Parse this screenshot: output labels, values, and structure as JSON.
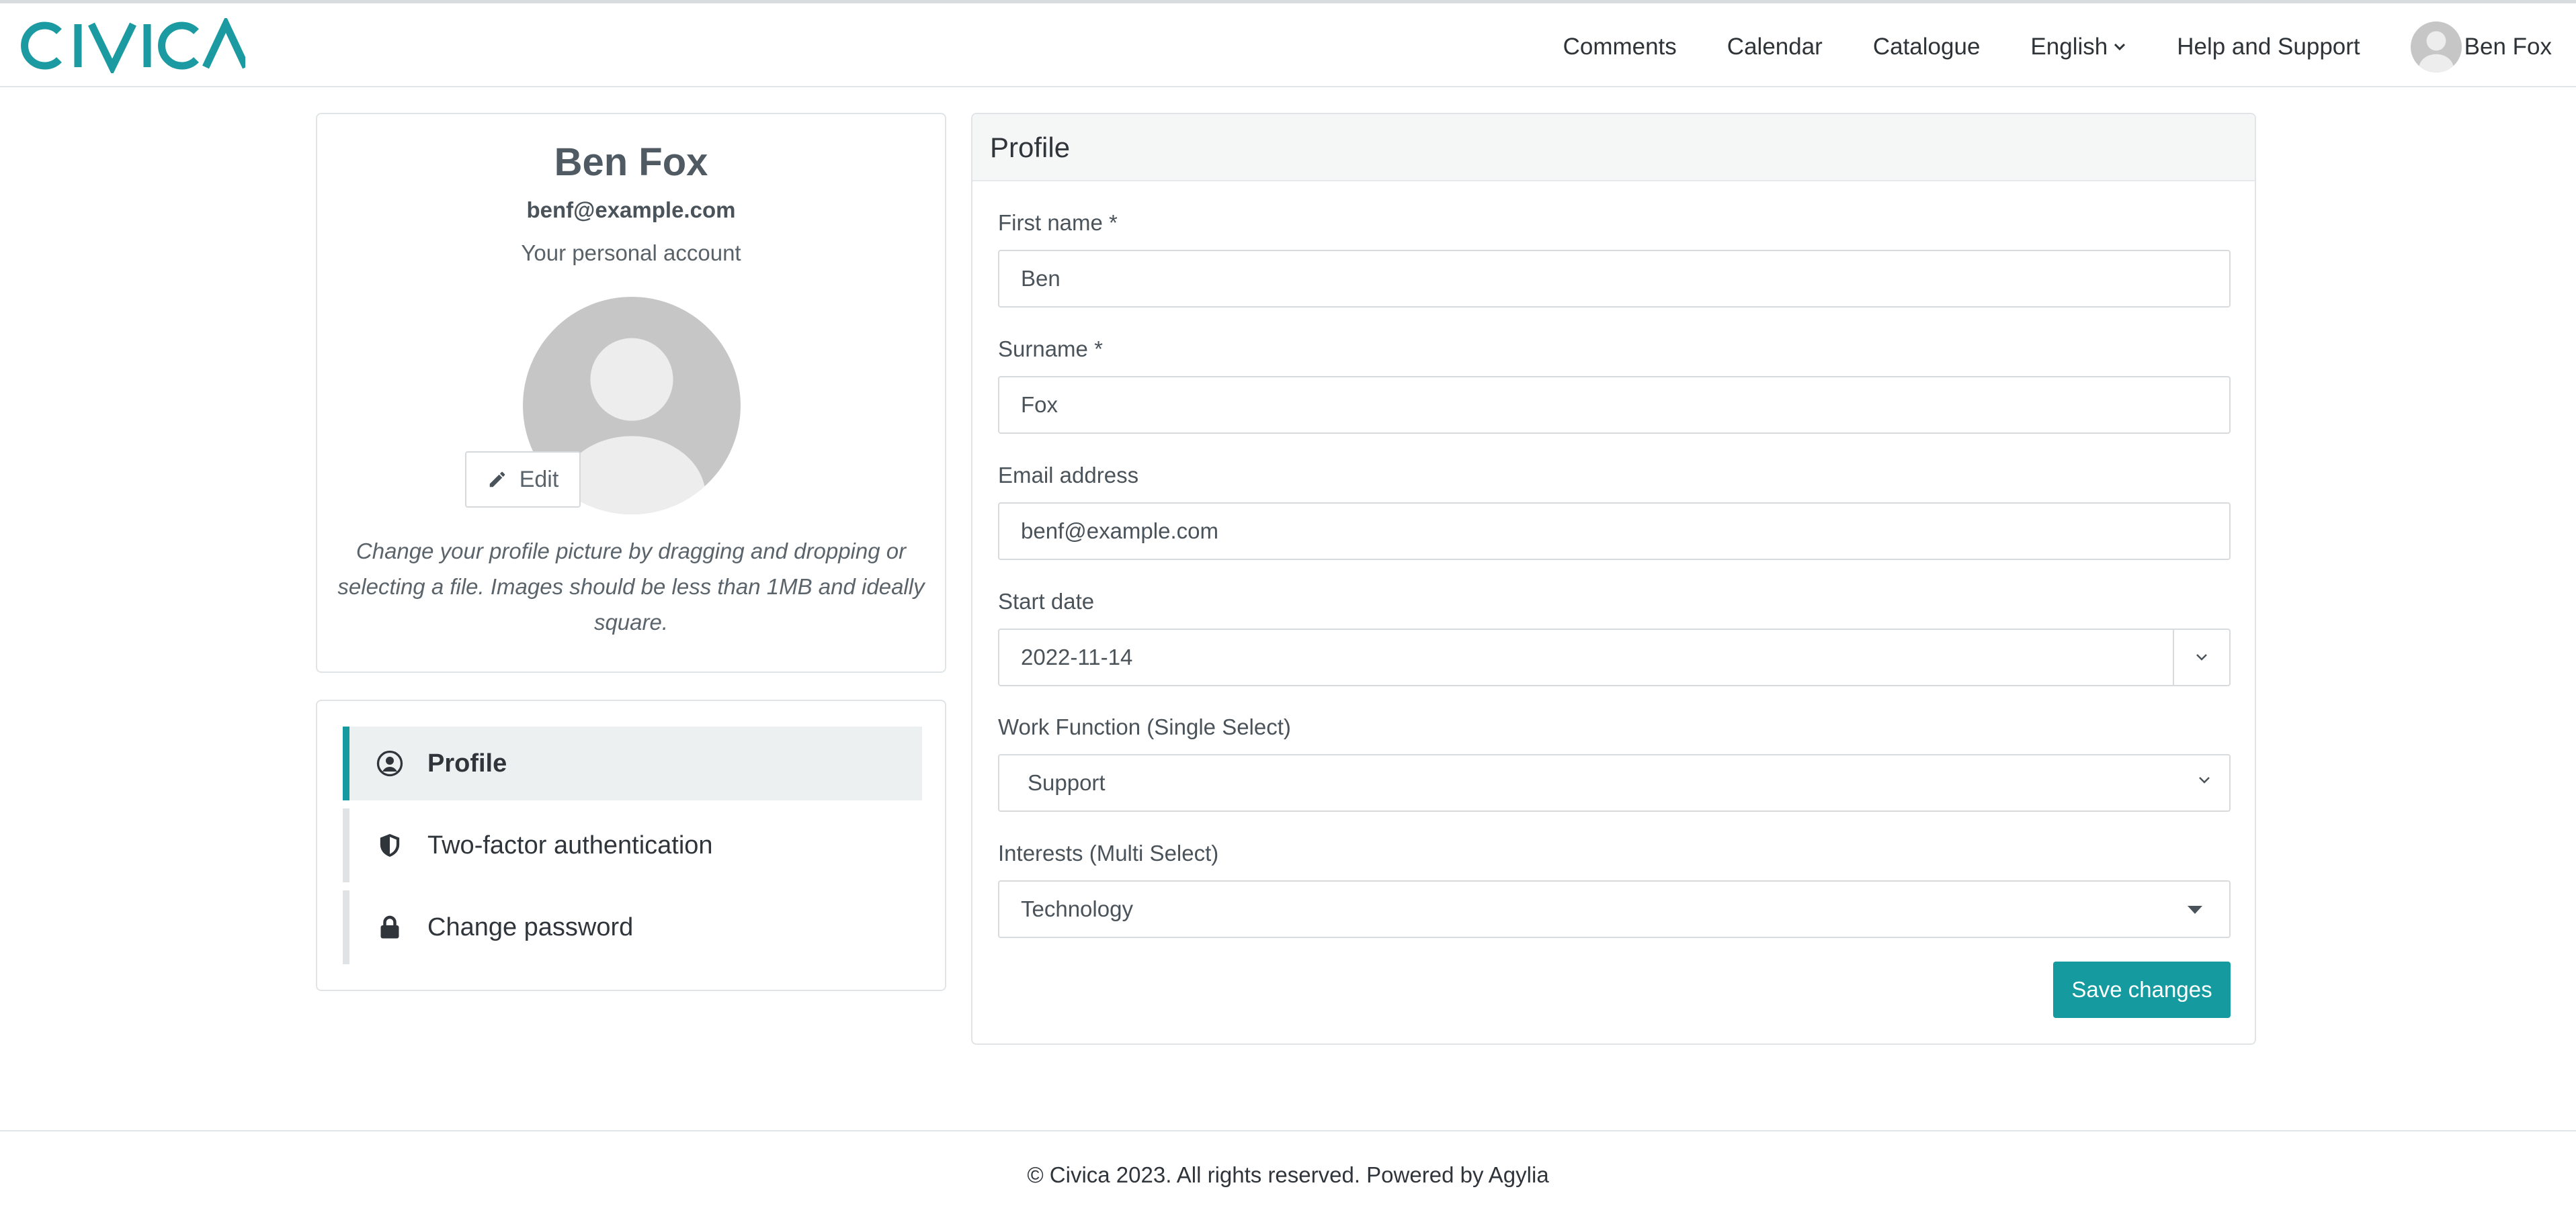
{
  "brand": {
    "logo_text": "CIVICA",
    "accent_color": "#159aa0"
  },
  "nav": {
    "items": [
      {
        "label": "Comments"
      },
      {
        "label": "Calendar"
      },
      {
        "label": "Catalogue"
      },
      {
        "label": "English"
      },
      {
        "label": "Help and Support"
      }
    ],
    "user_name": "Ben Fox"
  },
  "profile_card": {
    "name": "Ben Fox",
    "email": "benf@example.com",
    "account_label": "Your personal account",
    "edit_label": "Edit",
    "help_text": "Change your profile picture by dragging and dropping or selecting a file. Images should be less than 1MB and ideally square."
  },
  "menu": {
    "items": [
      {
        "label": "Profile",
        "icon": "user-circle-icon",
        "active": true
      },
      {
        "label": "Two-factor authentication",
        "icon": "shield-icon",
        "active": false
      },
      {
        "label": "Change password",
        "icon": "lock-icon",
        "active": false
      }
    ]
  },
  "form": {
    "title": "Profile",
    "first_name": {
      "label": "First name *",
      "value": "Ben"
    },
    "surname": {
      "label": "Surname *",
      "value": "Fox"
    },
    "email": {
      "label": "Email address",
      "value": "benf@example.com"
    },
    "start_date": {
      "label": "Start date",
      "value": "2022-11-14"
    },
    "work_function": {
      "label": "Work Function (Single Select)",
      "value": "Support"
    },
    "interests": {
      "label": "Interests (Multi Select)",
      "value": "Technology"
    },
    "save_label": "Save changes"
  },
  "footer": {
    "text": "© Civica 2023. All rights reserved. Powered by Agylia"
  }
}
